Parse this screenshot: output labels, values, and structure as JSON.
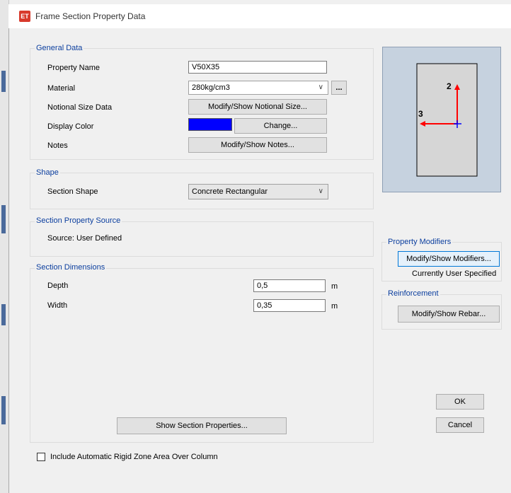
{
  "window": {
    "icon_text": "ET",
    "title": "Frame Section Property Data"
  },
  "general": {
    "title": "General Data",
    "property_name_label": "Property Name",
    "property_name_value": "V50X35",
    "material_label": "Material",
    "material_value": "280kg/cm3",
    "material_more_button": "...",
    "notional_label": "Notional Size Data",
    "notional_button": "Modify/Show Notional Size...",
    "display_color_label": "Display Color",
    "display_color_value": "#0000ff",
    "change_button": "Change...",
    "notes_label": "Notes",
    "notes_button": "Modify/Show Notes..."
  },
  "shape": {
    "title": "Shape",
    "section_shape_label": "Section Shape",
    "section_shape_value": "Concrete Rectangular"
  },
  "source": {
    "title": "Section Property Source",
    "source_text": "Source:  User Defined"
  },
  "dimensions": {
    "title": "Section Dimensions",
    "depth_label": "Depth",
    "depth_value": "0,5",
    "depth_unit": "m",
    "width_label": "Width",
    "width_value": "0,35",
    "width_unit": "m",
    "show_props_button": "Show Section Properties..."
  },
  "preview": {
    "axis2_label": "2",
    "axis3_label": "3",
    "axis2_color": "#ff0000",
    "axis3_color": "#ff0000",
    "origin_color": "#0000ff"
  },
  "modifiers": {
    "title": "Property Modifiers",
    "button": "Modify/Show Modifiers...",
    "status": "Currently User Specified"
  },
  "reinforcement": {
    "title": "Reinforcement",
    "button": "Modify/Show Rebar..."
  },
  "actions": {
    "ok": "OK",
    "cancel": "Cancel"
  },
  "rigid_zone": {
    "checked": false,
    "label": "Include Automatic Rigid Zone Area Over Column"
  }
}
